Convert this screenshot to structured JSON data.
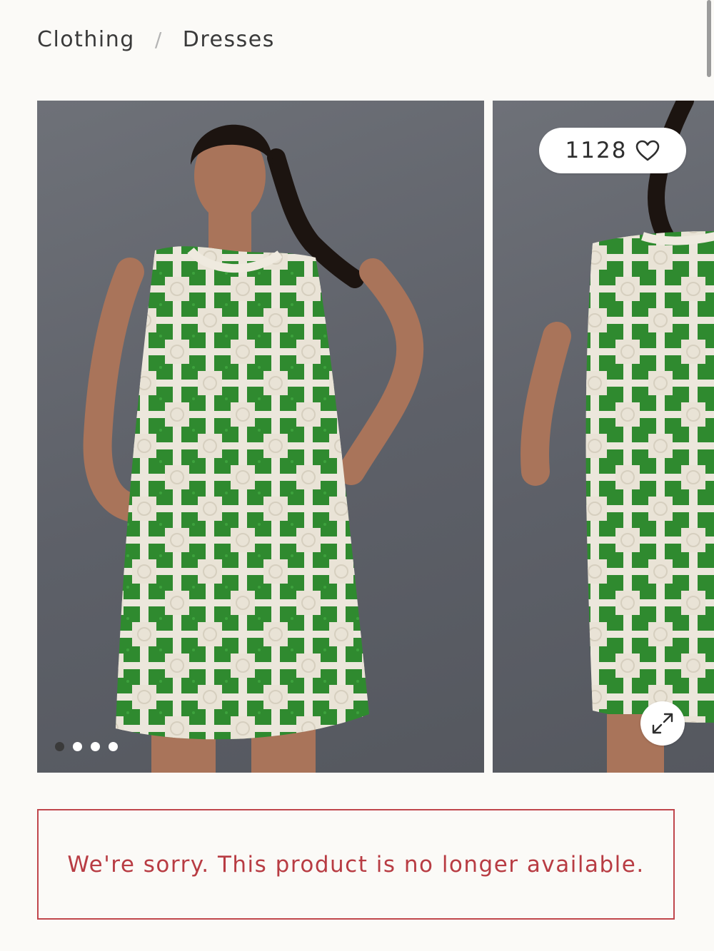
{
  "breadcrumb": {
    "items": [
      {
        "label": "Clothing"
      },
      {
        "label": "Dresses"
      }
    ],
    "separator": "/"
  },
  "gallery": {
    "favorite_count": "1128",
    "favorite_icon": "heart-outline-icon",
    "expand_icon": "expand-arrows-icon",
    "slides": [
      {
        "image": "model-front-green-crochet-shift-dress"
      },
      {
        "image": "model-back-green-crochet-shift-dress"
      }
    ],
    "dots": 4,
    "active_dot": 0
  },
  "notice": {
    "message": "We're sorry. This product is no longer available."
  },
  "colors": {
    "background": "#fbfaf7",
    "photo_backdrop": "#62656c",
    "dress_green": "#2f8a2f",
    "dress_cream": "#ece7dc",
    "notice_red": "#b83c43"
  }
}
